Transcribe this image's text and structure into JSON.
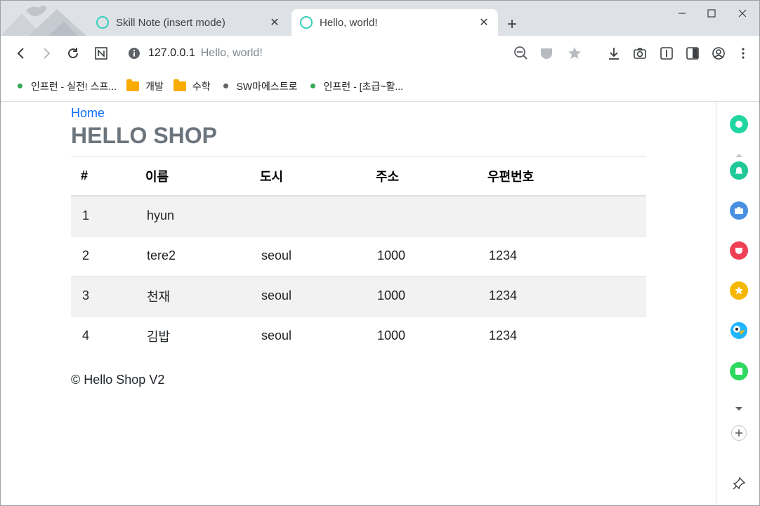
{
  "browser": {
    "tabs": [
      {
        "title": "Skill Note (insert mode)",
        "close": "✕"
      },
      {
        "title": "Hello, world!",
        "close": "✕"
      }
    ],
    "new_tab": "+",
    "address": {
      "host": "127.0.0.1",
      "page_title": "Hello, world!"
    },
    "bookmarks": [
      {
        "label": "인프런 - 실전! 스프...",
        "kind": "dot",
        "color": "#34a853"
      },
      {
        "label": "개발",
        "kind": "folder"
      },
      {
        "label": "수학",
        "kind": "folder"
      },
      {
        "label": "SW마에스트로",
        "kind": "dot",
        "color": "#5f6368"
      },
      {
        "label": "인프런 - [초급~활...",
        "kind": "dot",
        "color": "#34a853"
      }
    ]
  },
  "page": {
    "home_link": "Home",
    "brand": "HELLO SHOP",
    "table": {
      "headers": [
        "#",
        "이름",
        "도시",
        "주소",
        "우편번호"
      ],
      "rows": [
        [
          "1",
          "hyun",
          "",
          "",
          ""
        ],
        [
          "2",
          "tere2",
          "seoul",
          "1000",
          "1234"
        ],
        [
          "3",
          "천재",
          "seoul",
          "1000",
          "1234"
        ],
        [
          "4",
          "김밥",
          "seoul",
          "1000",
          "1234"
        ]
      ]
    },
    "footer": "© Hello Shop V2"
  },
  "colors": {
    "accent_link": "#0d6efd",
    "brand_text": "#6c757d",
    "tab_icon": "#35d0b8",
    "striped_row": "#f2f2f2"
  }
}
